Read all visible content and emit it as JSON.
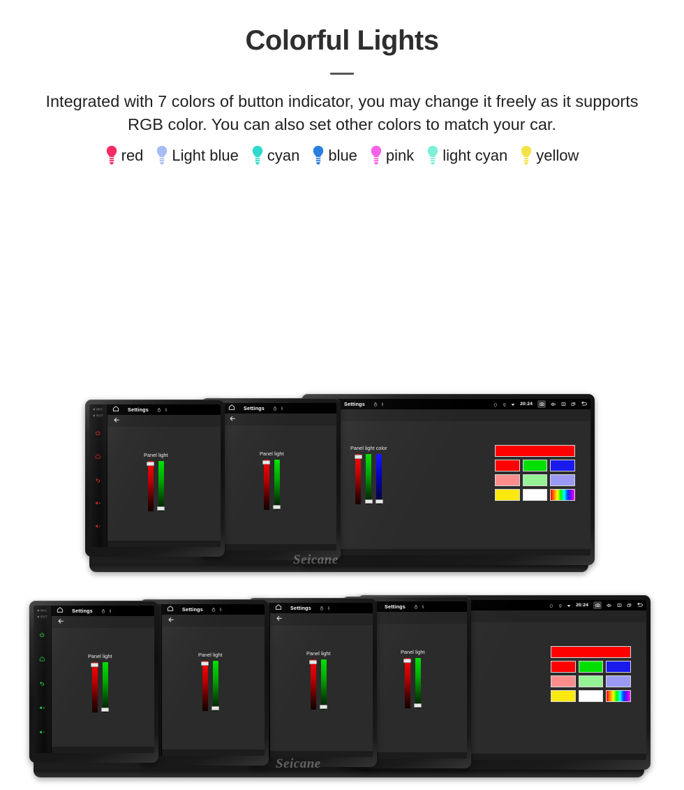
{
  "header": {
    "title": "Colorful Lights",
    "subtitle": "Integrated with 7 colors of button indicator, you may change it freely as it supports RGB color. You can also set other colors to match your car."
  },
  "legend": {
    "items": [
      {
        "label": "red",
        "color": "#f72a63"
      },
      {
        "label": "Light blue",
        "color": "#a8bdf5"
      },
      {
        "label": "cyan",
        "color": "#2fd9cd"
      },
      {
        "label": "blue",
        "color": "#2b7fe0"
      },
      {
        "label": "pink",
        "color": "#f862e8"
      },
      {
        "label": "light cyan",
        "color": "#7df0d7"
      },
      {
        "label": "yellow",
        "color": "#f2e246"
      }
    ]
  },
  "device_ui": {
    "home_icon": "home-icon",
    "settings_label": "Settings",
    "clock_icon": "timer-icon",
    "usb_icon": "usb-icon",
    "status_icons": [
      "shield-icon",
      "location-pin-icon",
      "wifi-icon"
    ],
    "clock_time": "20:24",
    "nav_icons": [
      "screenshot-camera-icon",
      "volume-icon",
      "close-x-icon",
      "recent-apps-icon",
      "back-arrow-icon"
    ],
    "back_arrow": "back-arrow-icon",
    "keystrip": {
      "mic_label": "MIC",
      "rst_label": "RST",
      "keys": [
        "power-icon",
        "home-icon",
        "back-icon",
        "volume-up-icon",
        "volume-down-icon"
      ]
    },
    "panel": {
      "label_short": "Panel light",
      "label_full": "Panel light color"
    },
    "palette": {
      "preview": "#ff0000",
      "rows": [
        [
          "#ff0000",
          "#00e000",
          "#1a1aee"
        ],
        [
          "#fb8d8d",
          "#95f295",
          "#9a9af5"
        ],
        [
          "#fbe80f",
          "#ffffff",
          "rainbow"
        ]
      ]
    },
    "watermark": "Seicane"
  },
  "rows": [
    {
      "name": "row-1",
      "units": [
        {
          "name": "unit-red",
          "accent": "#e02020",
          "wide": false
        },
        {
          "name": "unit-orange",
          "accent": "#f0a000",
          "wide": false
        },
        {
          "name": "unit-yellow",
          "accent": "#ece000",
          "wide": true
        }
      ]
    },
    {
      "name": "row-2",
      "units": [
        {
          "name": "unit-green",
          "accent": "#1fd93a",
          "wide": false
        },
        {
          "name": "unit-cyan",
          "accent": "#14d7c4",
          "wide": false
        },
        {
          "name": "unit-blue",
          "accent": "#2b2bf0",
          "wide": false
        },
        {
          "name": "unit-magenta",
          "accent": "#e818d8",
          "wide": false
        },
        {
          "name": "unit-magenta-wide",
          "accent": "#e818d8",
          "wide": true
        }
      ]
    }
  ]
}
